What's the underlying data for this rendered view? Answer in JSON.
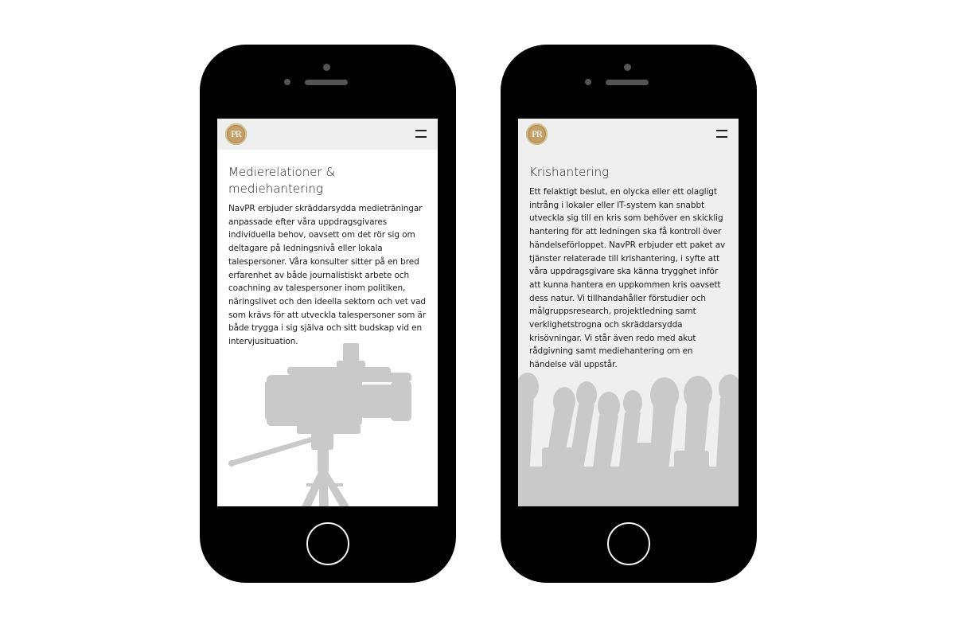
{
  "phones": [
    {
      "logo": "PR",
      "heading": "Medierelationer & mediehantering",
      "body": "NavPR erbjuder skräddarsydda medieträningar anpassade efter våra uppdragsgivares individuella behov, oavsett om det rör sig om deltagare på ledningsnivå eller lokala talespersoner. Våra konsulter sitter på en bred erfarenhet av både journalistiskt arbete och coachning av talespersoner inom politiken, näringslivet och den ideella sektorn och vet vad som krävs för att utveckla talespersoner som är både trygga i sig själva och sitt budskap vid en intervjusituation.",
      "illustration": "video-camera-silhouette"
    },
    {
      "logo": "PR",
      "heading": "Krishantering",
      "body": "Ett felaktigt beslut, en olycka eller ett olagligt intrång i lokaler eller IT-system kan snabbt utveckla sig till en kris som behöver en skicklig hantering för att ledningen ska få kontroll över händelseförloppet. NavPR erbjuder ett paket av tjänster relaterade till krishantering, i syfte att våra uppdragsgivare ska känna trygghet inför att kunna hantera en uppkommen kris oavsett dess natur. Vi tillhandahåller förstudier och målgruppsresearch, projektledning samt verklighetstrogna och skräddarsydda krisövningar. Vi står även redo med akut rådgivning samt mediehantering om en händelse väl uppstår.",
      "illustration": "microphones-silhouette"
    }
  ],
  "colors": {
    "phone_body": "#000000",
    "screen_grey": "#efefef",
    "logo_gold": "#c2a06a",
    "silhouette": "#c9c9c9"
  }
}
